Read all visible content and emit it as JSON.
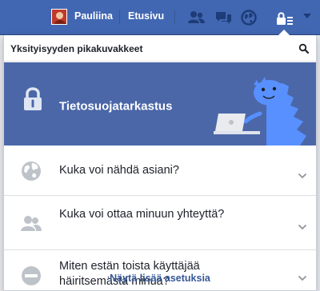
{
  "topbar": {
    "username": "Pauliina",
    "home_label": "Etusivu",
    "icons": [
      "friends-icon",
      "messages-icon",
      "globe-icon",
      "privacy-shortcuts-icon",
      "account-caret-icon"
    ]
  },
  "panel": {
    "title": "Yksityisyyden pikakuvakkeet",
    "search_icon": "search-icon",
    "banner": {
      "title": "Tietosuojatarkastus",
      "icon": "lock-icon",
      "illustration": "privacy-dinosaur-with-laptop"
    },
    "rows": [
      {
        "label": "Kuka voi nähdä asiani?",
        "icon": "globe-icon"
      },
      {
        "label": "Kuka voi ottaa minuun yhteyttä?",
        "icon": "people-icon"
      },
      {
        "label": "Miten estän toista käyttäjää häiritsemästä minua?",
        "icon": "block-icon"
      }
    ],
    "footer_link": "Näytä lisää asetuksia"
  },
  "colors": {
    "topbar_bg": "#4267b2",
    "banner_bg": "#4b67a8",
    "link": "#365899",
    "dino": "#5890ff"
  }
}
